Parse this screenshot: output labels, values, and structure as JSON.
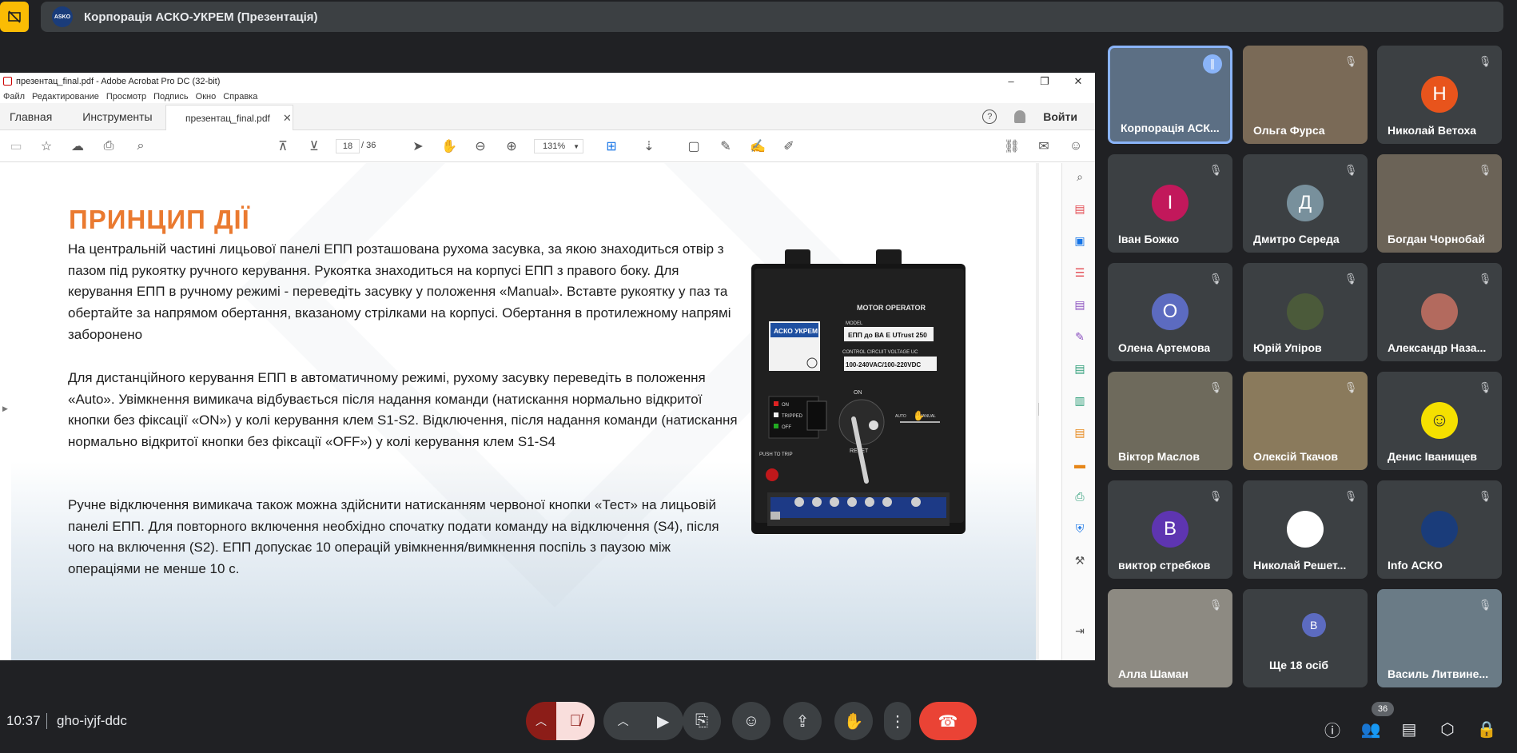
{
  "top": {
    "presentation_title": "Корпорація АСКО-УКРЕМ (Презентація)"
  },
  "acrobat": {
    "window_title": "презентац_final.pdf - Adobe Acrobat Pro DC (32-bit)",
    "menu": [
      "Файл",
      "Редактирование",
      "Просмотр",
      "Подпись",
      "Окно",
      "Справка"
    ],
    "tab_home": "Главная",
    "tab_tools": "Инструменты",
    "doc_tab": "презентац_final.pdf",
    "signin": "Войти",
    "page_current": "18",
    "page_total": "/ 36",
    "zoom": "131%"
  },
  "slide": {
    "title": "ПРИНЦИП ДІЇ",
    "p1": "На центральній частині лицьової панелі ЕПП розташована рухома засувка, за якою знаходиться отвір з пазом під рукоятку ручного керування. Рукоятка знаходиться на корпусі ЕПП з правого боку. Для керування ЕПП в ручному режимі - переведіть засувку у положення «Manual». Вставте рукоятку у паз та обертайте за напрямом обертання, вказаному стрілками на корпусі. Обертання в протилежному напрямі заборонено",
    "p2": "Для дистанційного керування ЕПП в автоматичному режимі, рухому засувку переведіть в положення «Auto». Увімкнення вимикача відбувається після надання команди (натискання нормально відкритої кнопки без фіксації «ON») у колі керування клем S1-S2. Відключення, після надання команди (натискання нормально відкритої кнопки без фіксації «OFF») у колі керування клем S1-S4",
    "p3": "Ручне відключення вимикача також можна здійснити натисканням червоної кнопки «Тест» на лицьовій панелі ЕПП. Для повторного включення необхідно спочатку подати команду на відключення (S4), після чого на включення (S2). ЕПП допускає 10 операцій увімкнення/вимкнення поспіль з паузою між операціями не менше 10 с.",
    "device": {
      "motor_operator": "MOTOR OPERATOR",
      "model_label": "MODEL",
      "model": "ЕПП до ВА Е UTrust 250",
      "voltage_label": "CONTROL CIRCUIT VOLTAGE  UC",
      "voltage": "100-240VAC/100-220VDC",
      "brand": "АСКО УКРЕМ",
      "on": "ON",
      "tripped": "TRIPPED",
      "off": "OFF",
      "push_to_trip": "PUSH TO TRIP",
      "auto": "AUTO",
      "manual": "MANUAL",
      "knob_on": "ON",
      "reset": "RESET"
    }
  },
  "participants": [
    {
      "name": "Корпорація АСК...",
      "initial": "",
      "color": "",
      "video": true
    },
    {
      "name": "Ольга Фурса",
      "initial": "",
      "color": "",
      "video": true
    },
    {
      "name": "Николай Ветоха",
      "initial": "Н",
      "color": "#e8541c",
      "video": false
    },
    {
      "name": "Іван Божко",
      "initial": "І",
      "color": "#c2185b",
      "video": false
    },
    {
      "name": "Дмитро Середа",
      "initial": "Д",
      "color": "#78909c",
      "video": false
    },
    {
      "name": "Богдан Чорнобай",
      "initial": "",
      "color": "",
      "video": true
    },
    {
      "name": "Олена Артемова",
      "initial": "О",
      "color": "#5c6bc0",
      "video": false
    },
    {
      "name": "Юрій Упіров",
      "initial": "",
      "color": "#4b5a3a",
      "video": false
    },
    {
      "name": "Александр Наза...",
      "initial": "",
      "color": "#b36a5e",
      "video": false
    },
    {
      "name": "Віктор Маслов",
      "initial": "",
      "color": "",
      "video": true
    },
    {
      "name": "Олексій Ткачов",
      "initial": "",
      "color": "",
      "video": true
    },
    {
      "name": "Денис Іванищев",
      "initial": "☺",
      "color": "#f5e000",
      "video": false
    },
    {
      "name": "виктор стребков",
      "initial": "В",
      "color": "#5e35b1",
      "video": false
    },
    {
      "name": "Николай Решет...",
      "initial": "",
      "color": "#ffffff",
      "video": false
    },
    {
      "name": "Info АСКО",
      "initial": "",
      "color": "#1a3c7a",
      "video": false
    },
    {
      "name": "Алла Шаман",
      "initial": "",
      "color": "",
      "video": true
    },
    {
      "name": "Ще 18 осіб",
      "initial": "В",
      "color": "#5c6bc0",
      "video": false
    },
    {
      "name": "Василь Литвине...",
      "initial": "",
      "color": "",
      "video": true
    }
  ],
  "bottom": {
    "time": "10:37",
    "meeting_code": "gho-iyjf-ddc",
    "people_count": "36"
  }
}
